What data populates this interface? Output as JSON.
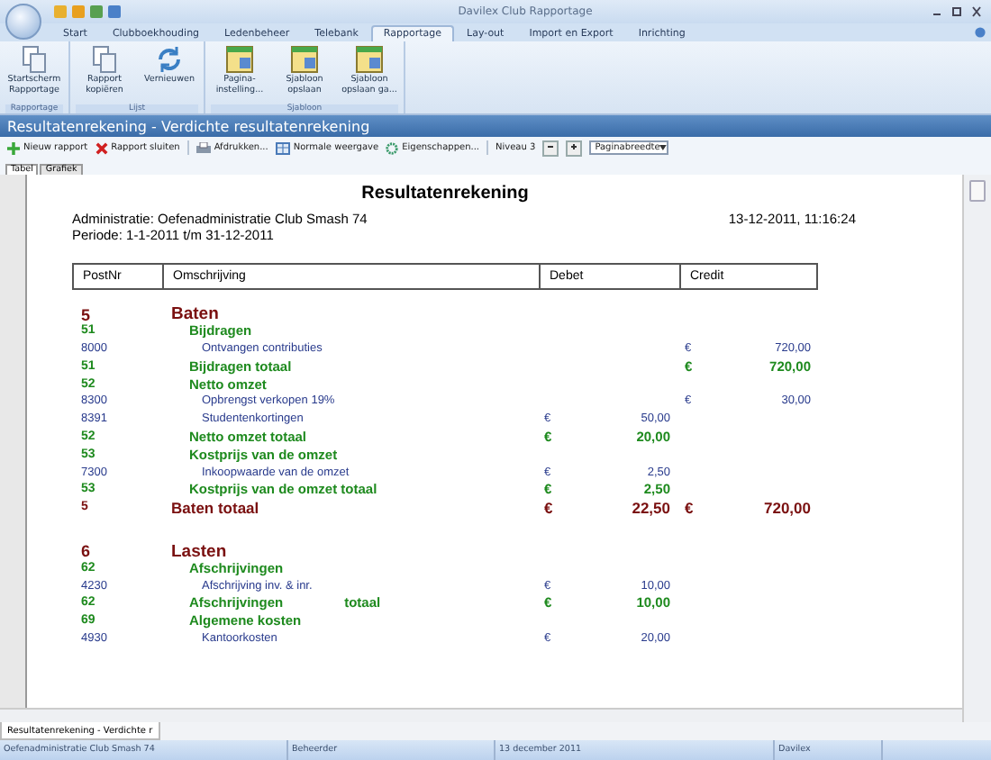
{
  "window": {
    "title": "Davilex Club Rapportage"
  },
  "ribbon_tabs": [
    {
      "label": "Start",
      "selected": false
    },
    {
      "label": "Clubboekhouding",
      "selected": false
    },
    {
      "label": "Ledenbeheer",
      "selected": false
    },
    {
      "label": "Telebank",
      "selected": false
    },
    {
      "label": "Rapportage",
      "selected": true
    },
    {
      "label": "Lay-out",
      "selected": false
    },
    {
      "label": "Import en Export",
      "selected": false
    },
    {
      "label": "Inrichting",
      "selected": false
    }
  ],
  "ribbon_groups": [
    {
      "label": "Rapportage",
      "buttons": [
        {
          "label": "Startscherm Rapportage",
          "kind": "pages"
        }
      ]
    },
    {
      "label": "Lijst",
      "buttons": [
        {
          "label": "Rapport kopiëren",
          "kind": "pages"
        },
        {
          "label": "Vernieuwen",
          "kind": "refresh"
        }
      ]
    },
    {
      "label": "Sjabloon",
      "buttons": [
        {
          "label": "Pagina-instelling...",
          "kind": "template"
        },
        {
          "label": "Sjabloon opslaan",
          "kind": "template"
        },
        {
          "label": "Sjabloon opslaan ga...",
          "kind": "template"
        }
      ]
    }
  ],
  "document": {
    "title": "Resultatenrekening - Verdichte resultatenrekening"
  },
  "toolbar": {
    "buttons": [
      {
        "label": "Nieuw rapport",
        "kind": "plus"
      },
      {
        "label": "Rapport sluiten",
        "kind": "cross"
      },
      {
        "label": "Afdrukken...",
        "kind": "printer"
      },
      {
        "label": "Normale weergave",
        "kind": "grid"
      },
      {
        "label": "Eigenschappen...",
        "kind": "gear"
      }
    ],
    "level_label": "Niveau 3",
    "zoom": "Paginabreedte"
  },
  "view_tabs": [
    {
      "label": "Tabel",
      "selected": true
    },
    {
      "label": "Grafiek",
      "selected": false
    }
  ],
  "report": {
    "title": "Resultatenrekening",
    "administration": "Administratie: Oefenadministratie Club Smash 74",
    "timestamp": "13-12-2011, 11:16:24",
    "period": "Periode: 1-1-2011 t/m 31-12-2011",
    "columns": [
      "PostNr",
      "Omschrijving",
      "Debet",
      "Credit"
    ],
    "rows": [
      {
        "kind": "group",
        "number": "5",
        "description": "Baten"
      },
      {
        "kind": "heading",
        "number": "51",
        "description": "Bijdragen"
      },
      {
        "kind": "account",
        "number": "8000",
        "description": "Ontvangen contributies",
        "credit": {
          "currency": "€",
          "amount": "720,00"
        }
      },
      {
        "kind": "subtotal",
        "number": "51",
        "description": "Bijdragen totaal",
        "credit": {
          "currency": "€",
          "amount": "720,00"
        }
      },
      {
        "kind": "heading",
        "number": "52",
        "description": "Netto omzet"
      },
      {
        "kind": "account",
        "number": "8300",
        "description": "Opbrengst verkopen 19%",
        "credit": {
          "currency": "€",
          "amount": "30,00"
        }
      },
      {
        "kind": "account",
        "number": "8391",
        "description": "Studentenkortingen",
        "debet": {
          "currency": "€",
          "amount": "50,00"
        }
      },
      {
        "kind": "subtotal",
        "number": "52",
        "description": "Netto omzet totaal",
        "debet": {
          "currency": "€",
          "amount": "20,00"
        }
      },
      {
        "kind": "heading",
        "number": "53",
        "description": "Kostprijs van de omzet"
      },
      {
        "kind": "account",
        "number": "7300",
        "description": "Inkoopwaarde van de omzet",
        "debet": {
          "currency": "€",
          "amount": "2,50"
        }
      },
      {
        "kind": "subtotal",
        "number": "53",
        "description": "Kostprijs van de omzet totaal",
        "debet": {
          "currency": "€",
          "amount": "2,50"
        }
      },
      {
        "kind": "total",
        "number": "5",
        "description": "Baten totaal",
        "debet": {
          "currency": "€",
          "amount": "22,50"
        },
        "credit": {
          "currency": "€",
          "amount": "720,00"
        }
      },
      {
        "kind": "spacer"
      },
      {
        "kind": "group",
        "number": "6",
        "description": "Lasten"
      },
      {
        "kind": "heading",
        "number": "62",
        "description": "Afschrijvingen"
      },
      {
        "kind": "account",
        "number": "4230",
        "description": "Afschrijving inv. & inr.",
        "debet": {
          "currency": "€",
          "amount": "10,00"
        }
      },
      {
        "kind": "subtotal",
        "number": "62",
        "description": "Afschrijvingen",
        "suffix": "totaal",
        "debet": {
          "currency": "€",
          "amount": "10,00"
        }
      },
      {
        "kind": "heading",
        "number": "69",
        "description": "Algemene kosten"
      },
      {
        "kind": "account",
        "number": "4930",
        "description": "Kantoorkosten",
        "debet": {
          "currency": "€",
          "amount": "20,00"
        }
      }
    ]
  },
  "document_tabs": [
    {
      "label": "Resultatenrekening - Verdichte r",
      "selected": true
    }
  ],
  "status_bar": [
    "Oefenadministratie Club Smash 74",
    "Beheerder",
    "13 december 2011",
    "Davilex"
  ]
}
